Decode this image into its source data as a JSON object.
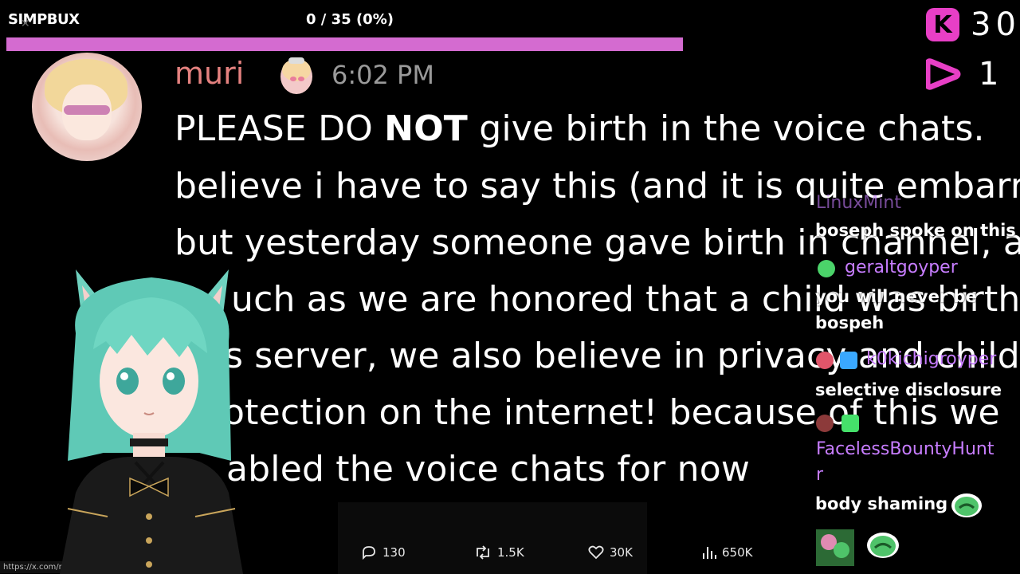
{
  "goal": {
    "title": "SIMPBUX",
    "progress_text": "0 / 35 (0%)",
    "progress_fraction": 0.0
  },
  "stats": {
    "kick_icon": "kick-icon",
    "kick_value": "30",
    "play_icon": "play-icon",
    "play_value": "1"
  },
  "message": {
    "author": "muri",
    "author_color": "#e4817f",
    "time": "6:02 PM",
    "lines": [
      {
        "pre": "PLEASE DO ",
        "bold": "NOT",
        "post": " give birth in the voice chats."
      },
      {
        "pre": "believe i have to say this (and it is quite embarr",
        "bold": "",
        "post": ""
      },
      {
        "pre": "but yesterday someone gave birth in channel, a",
        "bold": "",
        "post": ""
      },
      {
        "pre": "uch as we are honored that a child was birth",
        "bold": "",
        "post": ""
      },
      {
        "pre": "s server, we also believe in privacy and child",
        "bold": "",
        "post": ""
      },
      {
        "pre": "otection on the internet! because of this we",
        "bold": "",
        "post": ""
      },
      {
        "pre": "abled the voice chats for now",
        "bold": "",
        "post": ""
      }
    ]
  },
  "tweet_actions": {
    "replies": "130",
    "reposts": "1.5K",
    "likes": "30K",
    "views": "650K"
  },
  "url_tooltip": "https://x.com/m",
  "chat": [
    {
      "user": "LinuxMint",
      "color": "#c77dff",
      "text": "boseph spoke on this"
    },
    {
      "user": "geraltgoyper",
      "color": "#c77dff",
      "text": "you will never be bospeh"
    },
    {
      "user": "k0kichigroyper",
      "color": "#c77dff",
      "text": "selective disclosure"
    },
    {
      "user": "FacelessBountyHunter",
      "color": "#c77dff",
      "text": "body shaming"
    }
  ],
  "chat_line_breaks": {
    "user_4_part1": "FacelessBountyHunt",
    "user_4_part2": "r",
    "text_2_part1": "you will never be",
    "text_2_part2": "bospeh"
  },
  "colors": {
    "accent_pink": "#e83fc6",
    "goal_bar": "#d46bd0",
    "chat_name": "#c77dff"
  }
}
